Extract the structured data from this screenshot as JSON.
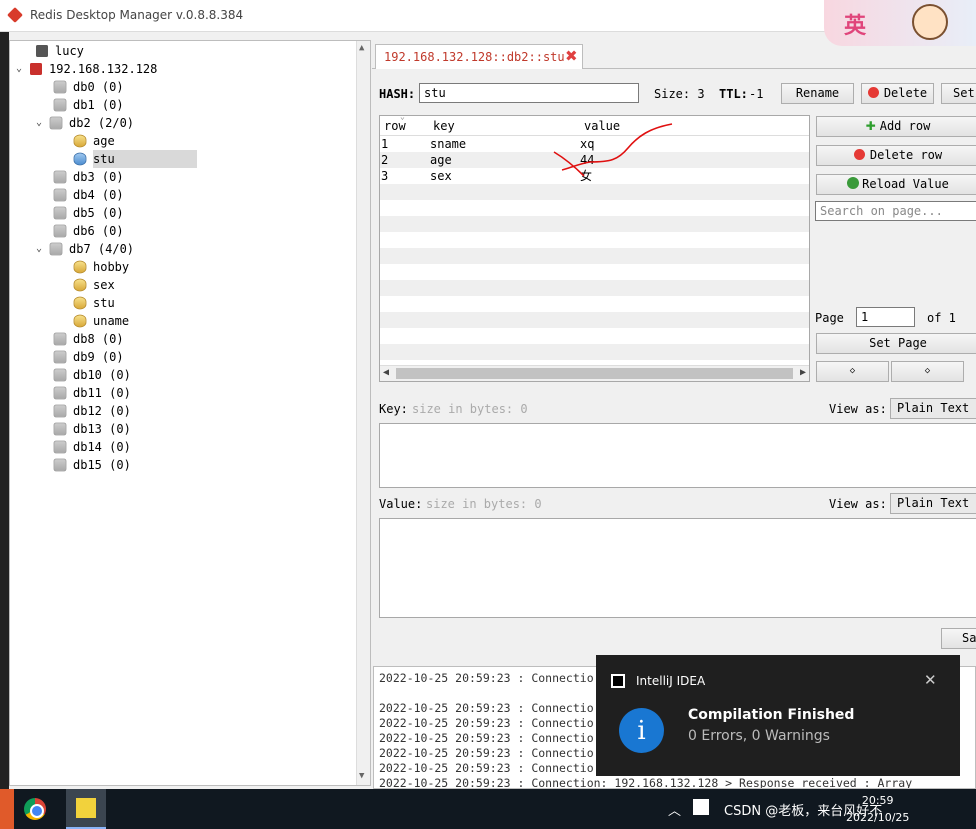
{
  "window": {
    "title": "Redis Desktop Manager v.0.8.8.384"
  },
  "tree": {
    "nodes": [
      {
        "label": "lucy",
        "icon": "server-icon"
      },
      {
        "label": "192.168.132.128",
        "icon": "server-icon"
      },
      {
        "label": "db0  (0)"
      },
      {
        "label": "db1  (0)"
      },
      {
        "label": "db2  (2/0)"
      },
      {
        "label": "age"
      },
      {
        "label": "stu"
      },
      {
        "label": "db3  (0)"
      },
      {
        "label": "db4  (0)"
      },
      {
        "label": "db5  (0)"
      },
      {
        "label": "db6  (0)"
      },
      {
        "label": "db7  (4/0)"
      },
      {
        "label": "hobby"
      },
      {
        "label": "sex"
      },
      {
        "label": "stu"
      },
      {
        "label": "uname"
      },
      {
        "label": "db8  (0)"
      },
      {
        "label": "db9  (0)"
      },
      {
        "label": "db10  (0)"
      },
      {
        "label": "db11  (0)"
      },
      {
        "label": "db12  (0)"
      },
      {
        "label": "db13  (0)"
      },
      {
        "label": "db14  (0)"
      },
      {
        "label": "db15  (0)"
      }
    ]
  },
  "tab": {
    "label": "192.168.132.128::db2::stu"
  },
  "key_header": {
    "type_label": "HASH:",
    "key_value": "stu",
    "size_label": "Size: 3",
    "ttl_label": "TTL:",
    "ttl_value": "-1",
    "rename": "Rename",
    "delete": "Delete",
    "set_ttl": "Set"
  },
  "table": {
    "columns": [
      "row",
      "key",
      "value"
    ],
    "rows": [
      [
        "1",
        "sname",
        "xq"
      ],
      [
        "2",
        "age",
        "44"
      ],
      [
        "3",
        "sex",
        "女"
      ]
    ]
  },
  "side": {
    "add_row": "Add row",
    "delete_row": "Delete row",
    "reload_value": "Reload Value",
    "search_placeholder": "Search on page...",
    "page_label": "Page",
    "page_value": "1",
    "of_label": "of 1",
    "set_page": "Set Page",
    "prev": "◇",
    "next": "◇"
  },
  "key_editor": {
    "label": "Key:",
    "size_hint": "size in bytes: 0",
    "view_as": "View as:",
    "format": "Plain Text"
  },
  "value_editor": {
    "label": "Value:",
    "size_hint": "size in bytes: 0",
    "view_as": "View as:",
    "format": "Plain Text",
    "save": "Sa"
  },
  "log": {
    "lines": [
      "2022-10-25 20:59:23 : Connectio",
      "",
      "2022-10-25 20:59:23 : Connectio",
      "2022-10-25 20:59:23 : Connectio",
      "2022-10-25 20:59:23 : Connectio",
      "2022-10-25 20:59:23 : Connectio",
      "2022-10-25 20:59:23 : Connectio",
      "2022-10-25 20:59:23 : Connection: 192.168.132.128 > Response received : Array"
    ]
  },
  "toast": {
    "app": "IntelliJ IDEA",
    "headline": "Compilation Finished",
    "body": "0 Errors, 0 Warnings"
  },
  "taskbar": {
    "time": "20:59",
    "date": "2022/10/25",
    "tray_text": "CSDN @老板，来台风好不"
  }
}
